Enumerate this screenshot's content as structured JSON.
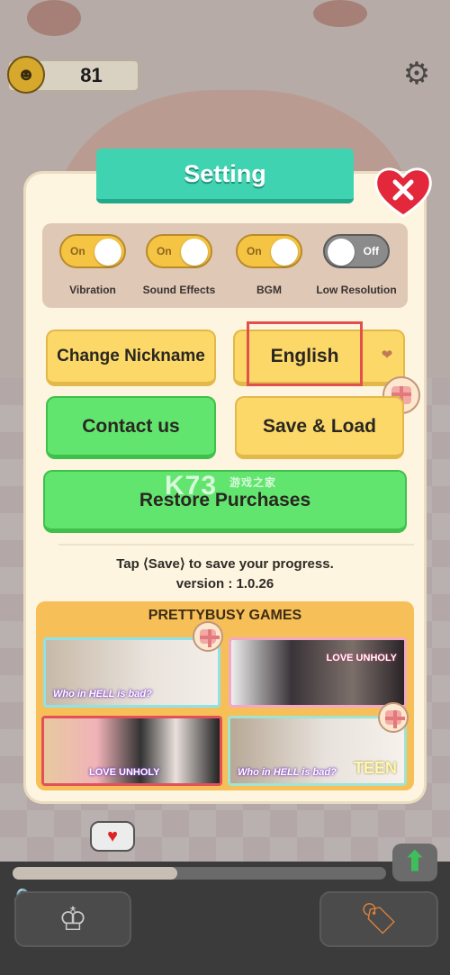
{
  "hud": {
    "coins": "81"
  },
  "dialog": {
    "title": "Setting",
    "toggles": [
      {
        "label": "Vibration",
        "state": "On"
      },
      {
        "label": "Sound Effects",
        "state": "On"
      },
      {
        "label": "BGM",
        "state": "On"
      },
      {
        "label": "Low Resolution",
        "state": "Off"
      }
    ],
    "buttons": {
      "change_nickname": "Change Nickname",
      "language": "English",
      "contact_us": "Contact us",
      "save_load": "Save & Load",
      "restore_purchases": "Restore Purchases"
    },
    "save_hint": "Tap ⟨Save⟩ to save your progress.",
    "version": "version : 1.0.26",
    "games": {
      "title": "PRETTYBUSY GAMES",
      "cards": [
        {
          "caption": "Who in HELL is bad?",
          "border": "#8fe3e8",
          "bg": "#d8cfc8"
        },
        {
          "caption": "LOVE UNHOLY",
          "border": "#f2a9c4",
          "bg": "#5a5358"
        },
        {
          "caption": "LOVE UNHOLY",
          "border": "#e3505a",
          "bg": "#e9a9a8"
        },
        {
          "caption": "Who in HELL is bad?",
          "badge": "TEEN",
          "border": "#9fe3d0",
          "bg": "#d5cdc6"
        }
      ]
    }
  },
  "watermark": {
    "text": "K73",
    "sub": "游戏之家"
  },
  "bottom": {
    "progress": 0.44
  },
  "colors": {
    "banner": "#3fd3b2",
    "yellow_button": "#fbd868",
    "green_button": "#62e56e",
    "highlight": "#e2504e"
  }
}
